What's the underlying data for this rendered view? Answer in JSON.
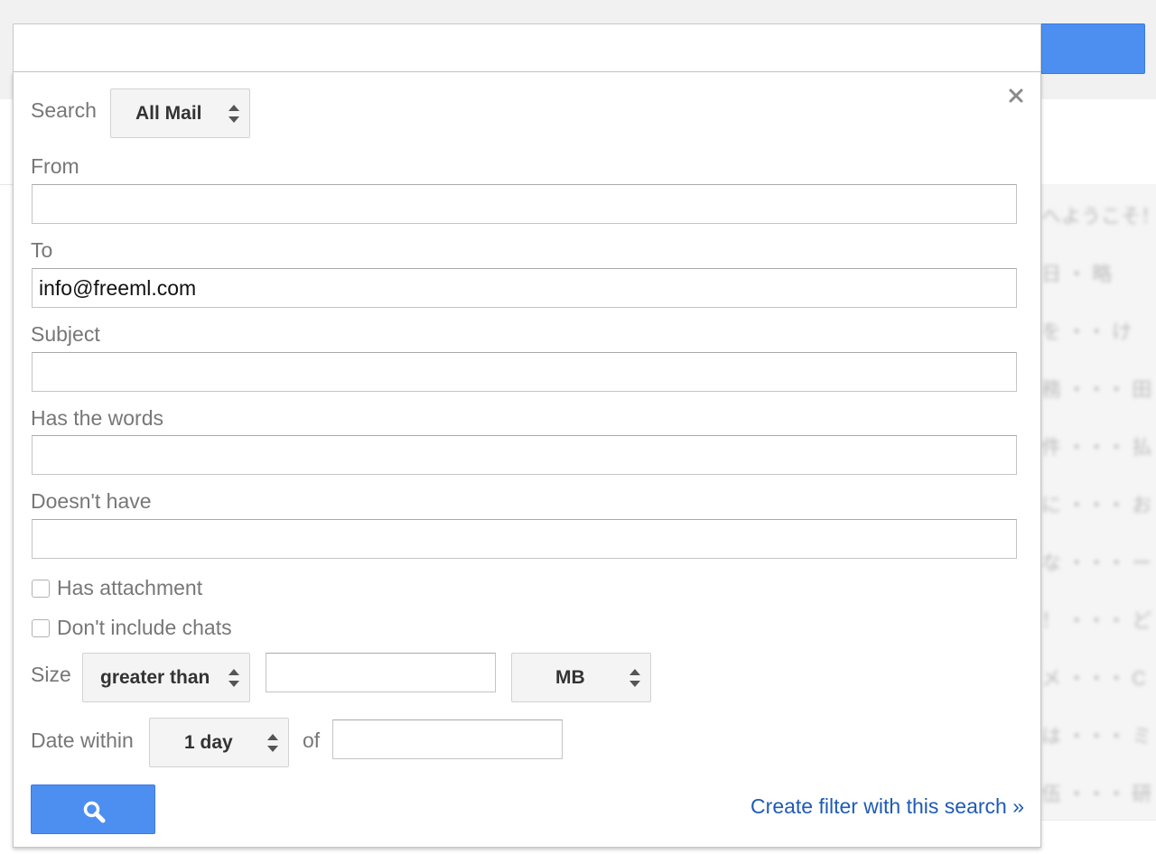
{
  "search": {
    "query": "",
    "submit_icon": "search-icon"
  },
  "panel": {
    "close_icon": "close-icon",
    "search_in_label": "Search",
    "search_in_value": "All Mail",
    "from_label": "From",
    "from_value": "",
    "to_label": "To",
    "to_value": "info@freeml.com",
    "subject_label": "Subject",
    "subject_value": "",
    "has_words_label": "Has the words",
    "has_words_value": "",
    "doesnt_have_label": "Doesn't have",
    "doesnt_have_value": "",
    "has_attachment_label": "Has attachment",
    "has_attachment_checked": false,
    "no_chats_label": "Don't include chats",
    "no_chats_checked": false,
    "size_label": "Size",
    "size_operator": "greater than",
    "size_value": "",
    "size_unit": "MB",
    "date_within_label": "Date within",
    "date_within_value": "1 day",
    "date_of_label": "of",
    "date_of_value": "",
    "search_button_icon": "search-icon",
    "create_filter_link": "Create filter with this search »"
  },
  "colors": {
    "primary_button": "#4d8ff0",
    "link": "#1f5bb3",
    "label": "#777777"
  }
}
